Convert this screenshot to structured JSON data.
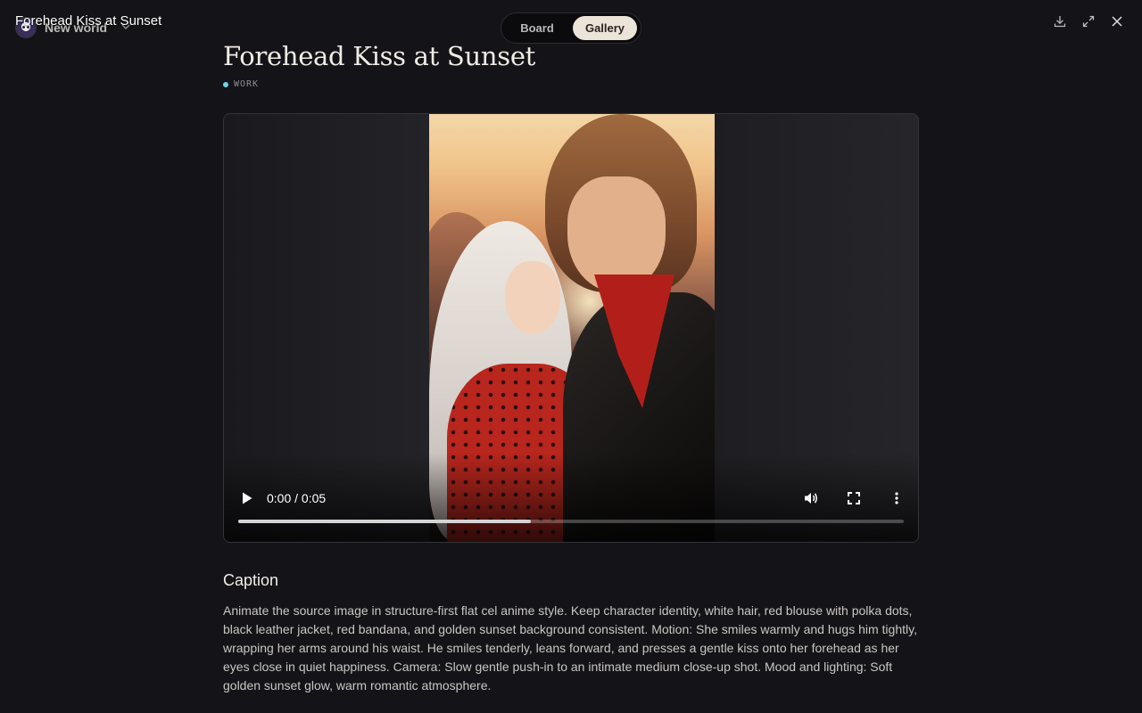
{
  "window": {
    "title": "Forehead Kiss at Sunset"
  },
  "workspace": {
    "name": "New world",
    "avatar_icon": "anime-girl-avatar",
    "chevron_icon": "chevron-down-icon"
  },
  "view_toggle": {
    "tabs": [
      {
        "label": "Board",
        "active": false
      },
      {
        "label": "Gallery",
        "active": true
      }
    ]
  },
  "actions": {
    "download_icon": "download-icon",
    "expand_icon": "expand-icon",
    "close_icon": "close-icon"
  },
  "item": {
    "title": "Forehead Kiss at Sunset",
    "tag": "WORK",
    "tag_color": "#6fd3e6"
  },
  "video": {
    "time_display": "0:00 / 0:05",
    "buffered_fraction": 0.44,
    "play_icon": "play-icon",
    "volume_icon": "volume-icon",
    "fullscreen_icon": "fullscreen-icon",
    "more_icon": "more-vertical-icon"
  },
  "caption": {
    "heading": "Caption",
    "text": "Animate the source image in structure-first flat cel anime style. Keep character identity, white hair, red blouse with polka dots, black leather jacket, red bandana, and golden sunset background consistent. Motion: She smiles warmly and hugs him tightly, wrapping her arms around his waist. He smiles tenderly, leans forward, and presses a gentle kiss onto her forehead as her eyes close in quiet happiness. Camera: Slow gentle push-in to an intimate medium close-up shot. Mood and lighting: Soft golden sunset glow, warm romantic atmosphere."
  },
  "colors": {
    "background": "#141418",
    "toggle_active": "#ebe4d8"
  }
}
